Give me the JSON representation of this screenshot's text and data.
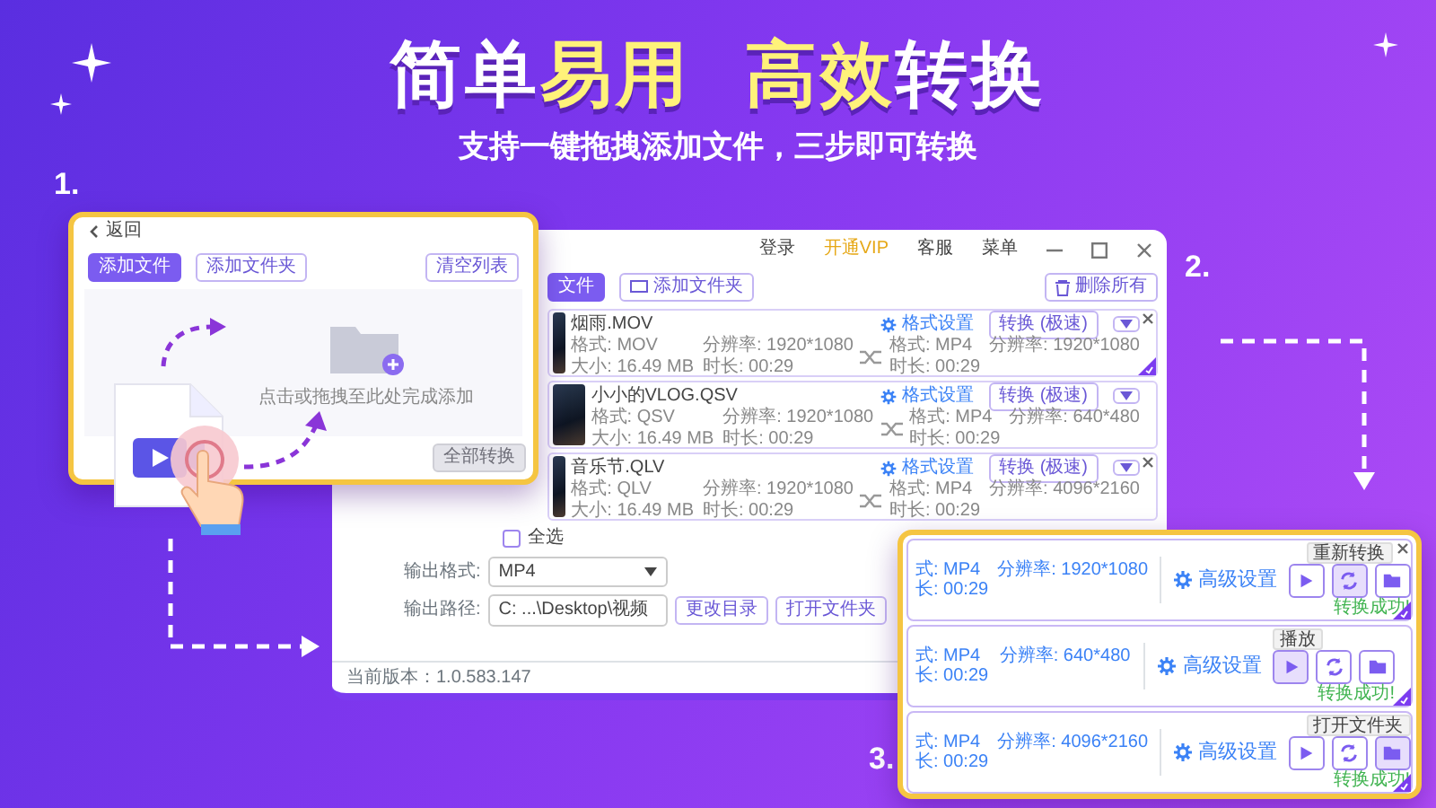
{
  "headline": [
    [
      {
        "text": "简单",
        "highlight": false
      },
      {
        "text": "易用",
        "highlight": true
      }
    ],
    [
      {
        "text": "高效",
        "highlight": true
      },
      {
        "text": "转换",
        "highlight": false
      }
    ]
  ],
  "subtitle": "支持一键拖拽添加文件，三步即可转换",
  "steps": [
    "1.",
    "2.",
    "3."
  ],
  "import_window": {
    "back": "返回",
    "toolbar": [
      {
        "label": "添加文件",
        "primary": true
      },
      {
        "label": "添加文件夹",
        "primary": false
      }
    ],
    "clear_list": "清空列表",
    "drop_hint": "点击或拖拽至此处完成添加",
    "convert_all": {
      "label": "全部转换",
      "disabled": true
    }
  },
  "main_window": {
    "menu": [
      {
        "label": "登录",
        "highlight": false
      },
      {
        "label": "开通VIP",
        "highlight": true
      },
      {
        "label": "客服",
        "highlight": false
      },
      {
        "label": "菜单",
        "highlight": false
      }
    ],
    "toolbar": [
      {
        "label": "文件",
        "primary": true
      },
      {
        "label": "添加文件夹",
        "primary": false
      }
    ],
    "delete_all": "删除所有",
    "files": [
      {
        "name": "烟雨.MOV",
        "input": [
          "格式: MOV",
          "分辨率: 1920*1080",
          "大小: 16.49 MB",
          "时长: 00:29"
        ],
        "output": [
          "格式: MP4",
          "分辨率: 1920*1080",
          "时长: 00:29"
        ],
        "settings": "格式设置",
        "convert": "转换 (极速)",
        "checked": true,
        "close_shown": true
      },
      {
        "name": "小小的VLOG.QSV",
        "input": [
          "格式: QSV",
          "分辨率: 1920*1080",
          "大小: 16.49 MB",
          "时长: 00:29"
        ],
        "output": [
          "格式: MP4",
          "分辨率: 640*480",
          "时长: 00:29"
        ],
        "settings": "格式设置",
        "convert": "转换 (极速)",
        "checked": false,
        "close_shown": false
      },
      {
        "name": "音乐节.QLV",
        "input": [
          "格式: QLV",
          "分辨率: 1920*1080",
          "大小: 16.49 MB",
          "时长: 00:29"
        ],
        "output": [
          "格式: MP4",
          "分辨率: 4096*2160",
          "时长: 00:29"
        ],
        "settings": "格式设置",
        "convert": "转换 (极速)",
        "checked": false,
        "close_shown": true
      }
    ],
    "select_all": {
      "label": "全选",
      "checked": false
    },
    "output_format": {
      "label": "输出格式:",
      "value": "MP4"
    },
    "output_path": {
      "label": "输出路径:",
      "value": "C: ...\\Desktop\\视频"
    },
    "change_dir": "更改目录",
    "open_folder": "打开文件夹",
    "version": "当前版本：1.0.583.147"
  },
  "result_window": {
    "rows": [
      {
        "specs": [
          "式: MP4",
          "分辨率: 1920*1080",
          "长: 00:29"
        ],
        "settings": "高级设置",
        "buttons": [
          {
            "kind": "play",
            "selected": false
          },
          {
            "kind": "reconvert",
            "selected": true
          },
          {
            "kind": "folder",
            "selected": false
          }
        ],
        "tooltip": "重新转换",
        "status": "转换成功!",
        "checked": true,
        "close_shown": true
      },
      {
        "specs": [
          "式: MP4",
          "分辨率: 640*480",
          "长: 00:29"
        ],
        "settings": "高级设置",
        "buttons": [
          {
            "kind": "play",
            "selected": true
          },
          {
            "kind": "reconvert",
            "selected": false
          },
          {
            "kind": "folder",
            "selected": false
          }
        ],
        "tooltip": "播放",
        "status": "转换成功!",
        "checked": true,
        "close_shown": false
      },
      {
        "specs": [
          "式: MP4",
          "分辨率: 4096*2160",
          "长: 00:29"
        ],
        "settings": "高级设置",
        "buttons": [
          {
            "kind": "play",
            "selected": false
          },
          {
            "kind": "reconvert",
            "selected": false
          },
          {
            "kind": "folder",
            "selected": true
          }
        ],
        "tooltip": "打开文件夹",
        "status": "转换成功!",
        "checked": true,
        "close_shown": false
      }
    ]
  }
}
